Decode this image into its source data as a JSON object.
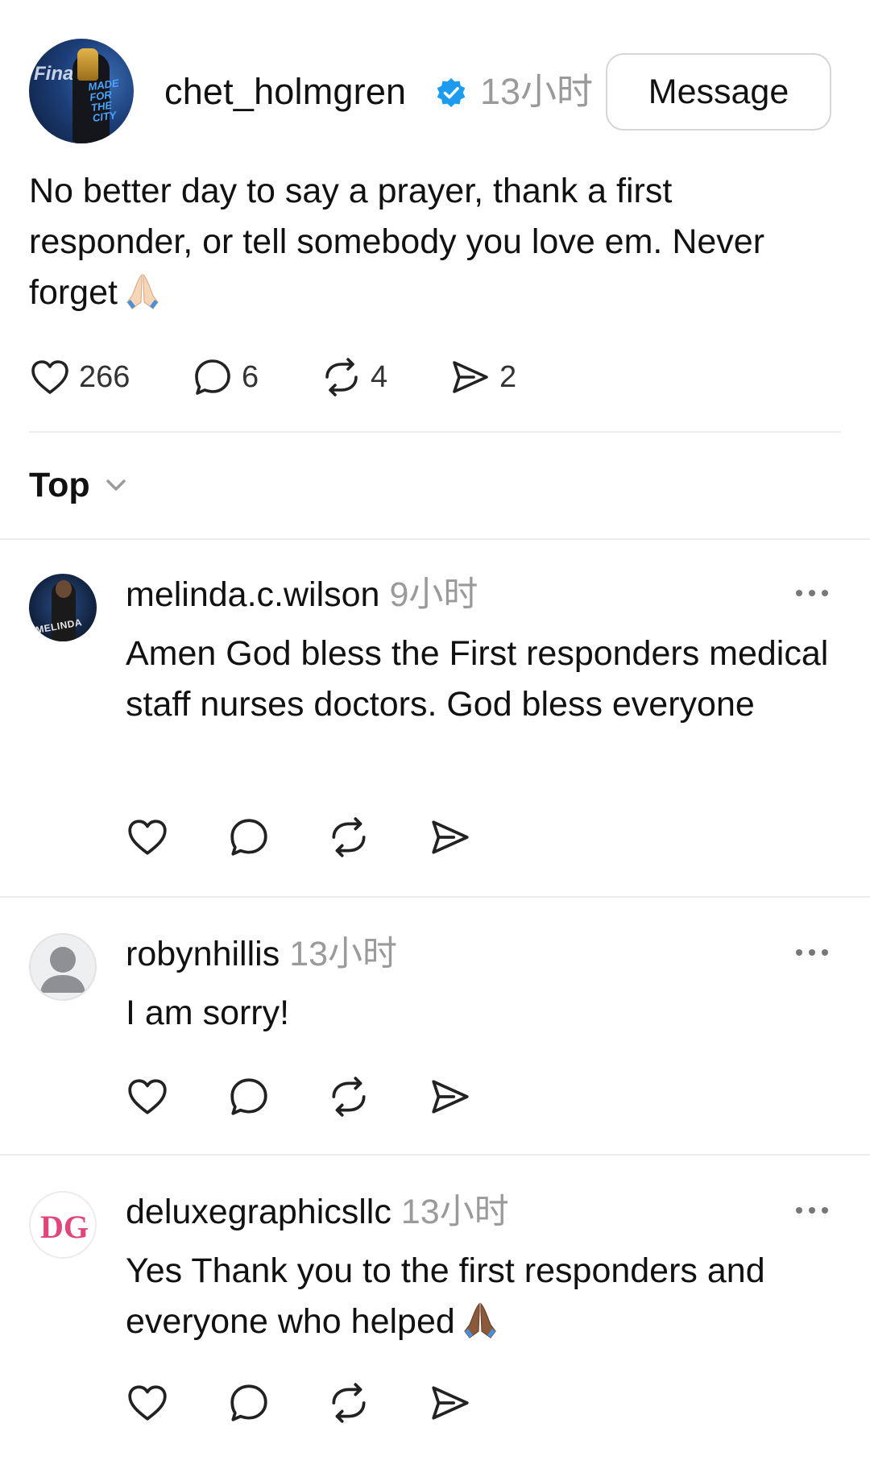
{
  "post": {
    "username": "chet_holmgren",
    "time": "13小时",
    "message_button": "Message",
    "text": "No better day to say a prayer, thank a first responder, or tell somebody you love em. Never forget",
    "avatar_text": "Finals",
    "avatar_shirt_text": "MADE FOR THE CITY",
    "counts": {
      "likes": "266",
      "replies": "6",
      "reposts": "4",
      "shares": "2"
    }
  },
  "sort": {
    "label": "Top"
  },
  "comments": [
    {
      "username": "melinda.c.wilson",
      "time": "9小时",
      "text": "Amen God bless the First responders medical staff nurses doctors. God bless everyone",
      "avatar_text": "MELINDA"
    },
    {
      "username": "robynhillis",
      "time": "13小时",
      "text": "I am sorry!"
    },
    {
      "username": "deluxegraphicsllc",
      "time": "13小时",
      "text": "Yes Thank you to the first responders and everyone who helped",
      "avatar_text": "DG"
    }
  ],
  "colors": {
    "verified": "#1d9bf0",
    "muted_text": "#9a9a9a",
    "divider": "#ececec",
    "deluxe_brand": "#e0467c",
    "pray_light": "#f5d7b8",
    "pray_dark": "#8b5a3c"
  },
  "icons": {
    "like": "heart-icon",
    "reply": "speech-bubble-icon",
    "repost": "repost-icon",
    "share": "send-icon",
    "more": "more-dots-icon",
    "sort": "chevron-down-icon",
    "verified": "verified-badge-icon"
  }
}
